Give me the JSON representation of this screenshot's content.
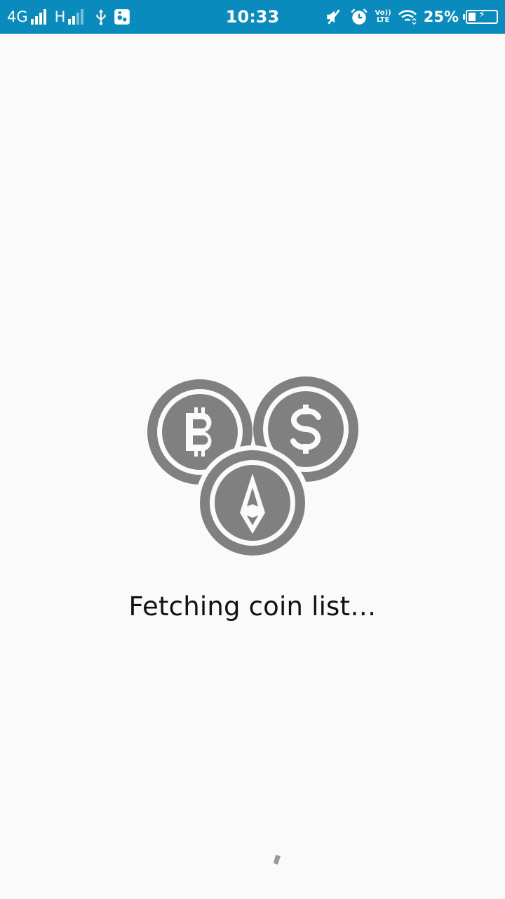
{
  "status_bar": {
    "network_label": "4G",
    "network2_label": "H",
    "time": "10:33",
    "battery_percent": "25%",
    "battery_level": 0.25,
    "volte_top": "Vo))",
    "volte_bottom": "LTE",
    "colors": {
      "background": "#0a8bbd",
      "foreground": "#ffffff"
    },
    "icons": [
      "signal-icon",
      "signal2-icon",
      "usb-icon",
      "apk-icon",
      "mute-icon",
      "alarm-icon",
      "volte-icon",
      "wifi-icon",
      "battery-icon"
    ]
  },
  "main": {
    "loading_message": "Fetching coin list…",
    "illustration": [
      "bitcoin-coin-icon",
      "dollar-coin-icon",
      "ethereum-coin-icon"
    ],
    "colors": {
      "icon": "#808080",
      "background": "#fafafa",
      "text": "#111111"
    }
  }
}
